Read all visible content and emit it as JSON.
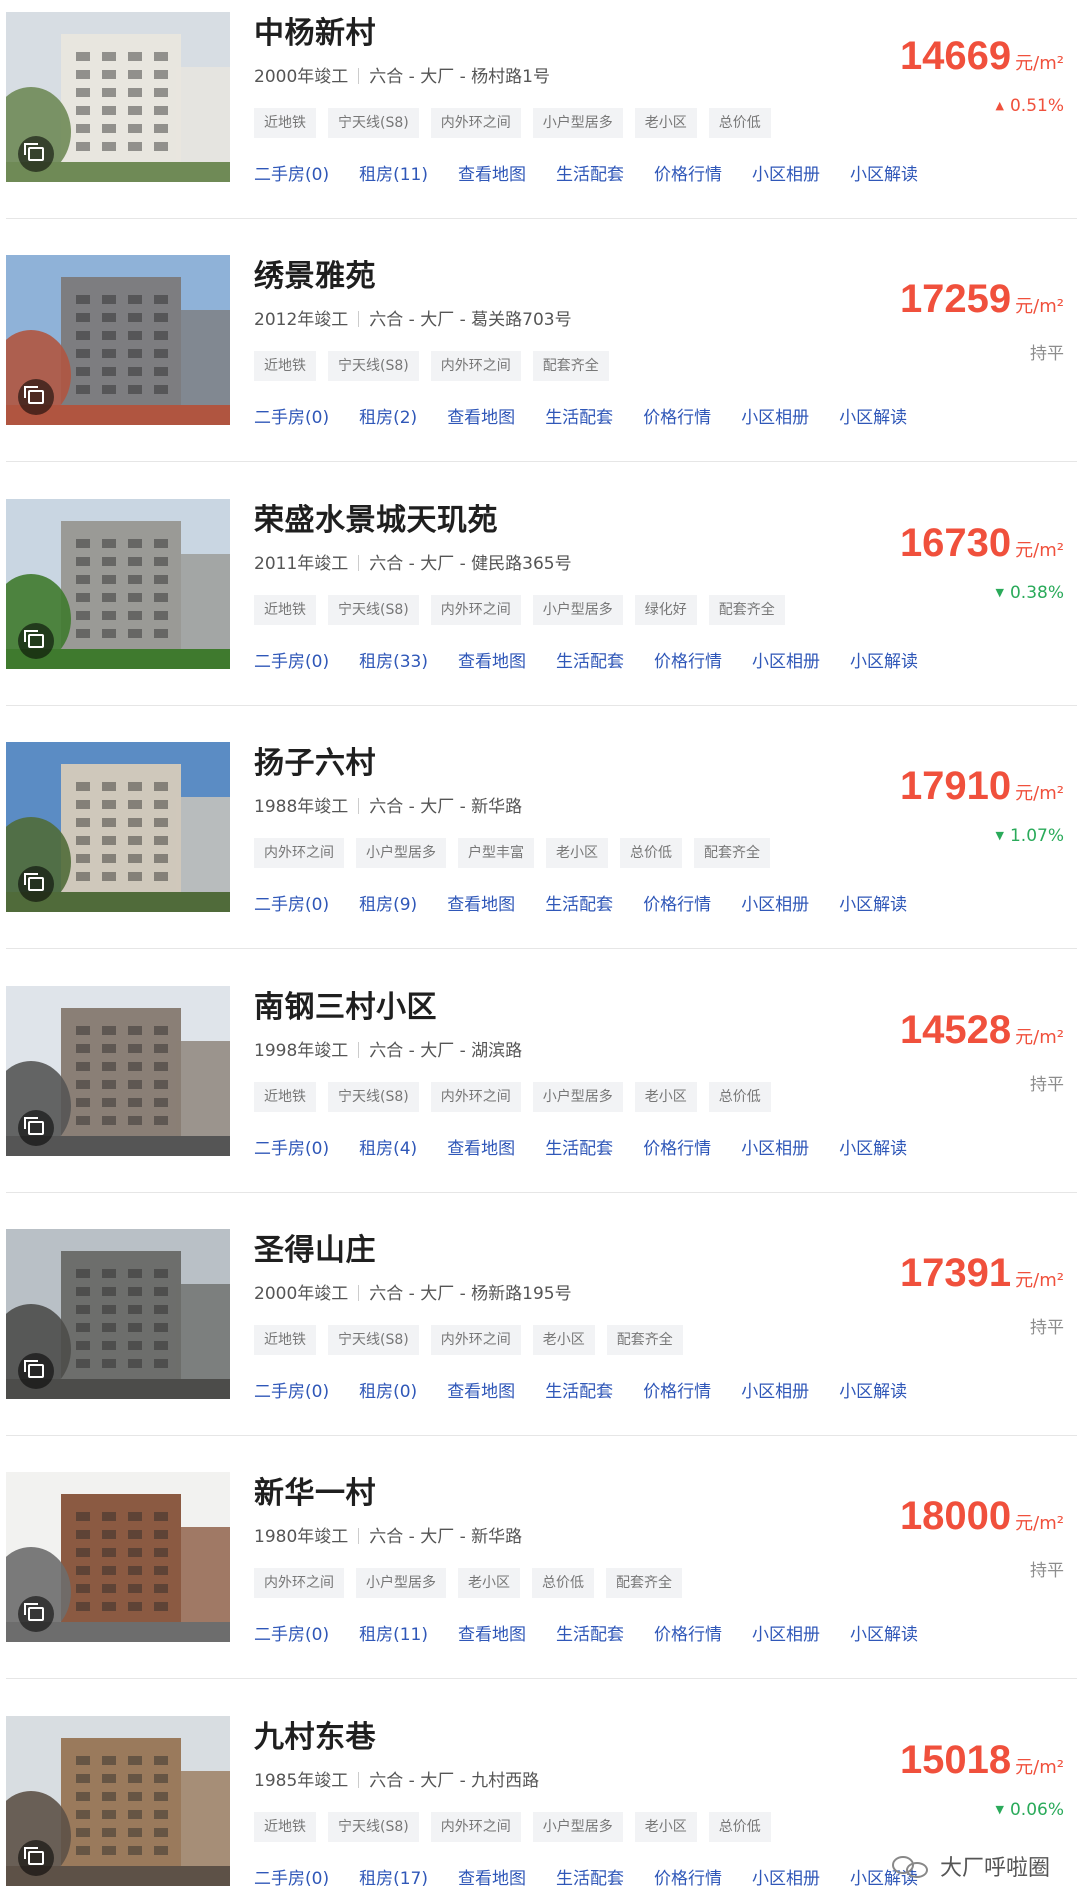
{
  "units": {
    "price_unit": "元/m²",
    "flat_label": "持平"
  },
  "listings": [
    {
      "name": "中杨新村",
      "year": "2000年竣工",
      "location": "六合 - 大厂 - 杨村路1号",
      "tags": [
        "近地铁",
        "宁天线(S8)",
        "内外环之间",
        "小户型居多",
        "老小区",
        "总价低"
      ],
      "links": [
        "二手房(0)",
        "租房(11)",
        "查看地图",
        "生活配套",
        "价格行情",
        "小区相册",
        "小区解读"
      ],
      "price": "14669",
      "trend": "up",
      "change": "0.51%",
      "photo_colors": {
        "sky": "#d7dde3",
        "building": "#e8e6df",
        "ground": "#6f8a56"
      }
    },
    {
      "name": "绣景雅苑",
      "year": "2012年竣工",
      "location": "六合 - 大厂 - 葛关路703号",
      "tags": [
        "近地铁",
        "宁天线(S8)",
        "内外环之间",
        "配套齐全"
      ],
      "links": [
        "二手房(0)",
        "租房(2)",
        "查看地图",
        "生活配套",
        "价格行情",
        "小区相册",
        "小区解读"
      ],
      "price": "17259",
      "trend": "flat",
      "change": "持平",
      "photo_colors": {
        "sky": "#8fb2d8",
        "building": "#7d7d80",
        "ground": "#b05540"
      }
    },
    {
      "name": "荣盛水景城天玑苑",
      "year": "2011年竣工",
      "location": "六合 - 大厂 - 健民路365号",
      "tags": [
        "近地铁",
        "宁天线(S8)",
        "内外环之间",
        "小户型居多",
        "绿化好",
        "配套齐全"
      ],
      "links": [
        "二手房(0)",
        "租房(33)",
        "查看地图",
        "生活配套",
        "价格行情",
        "小区相册",
        "小区解读"
      ],
      "price": "16730",
      "trend": "down",
      "change": "0.38%",
      "photo_colors": {
        "sky": "#c9d6e2",
        "building": "#9a9a96",
        "ground": "#3f7a2e"
      }
    },
    {
      "name": "扬子六村",
      "year": "1988年竣工",
      "location": "六合 - 大厂 - 新华路",
      "tags": [
        "内外环之间",
        "小户型居多",
        "户型丰富",
        "老小区",
        "总价低",
        "配套齐全"
      ],
      "links": [
        "二手房(0)",
        "租房(9)",
        "查看地图",
        "生活配套",
        "价格行情",
        "小区相册",
        "小区解读"
      ],
      "price": "17910",
      "trend": "down",
      "change": "1.07%",
      "photo_colors": {
        "sky": "#5b8cc4",
        "building": "#cfc8bb",
        "ground": "#506b3a"
      }
    },
    {
      "name": "南钢三村小区",
      "year": "1998年竣工",
      "location": "六合 - 大厂 - 湖滨路",
      "tags": [
        "近地铁",
        "宁天线(S8)",
        "内外环之间",
        "小户型居多",
        "老小区",
        "总价低"
      ],
      "links": [
        "二手房(0)",
        "租房(4)",
        "查看地图",
        "生活配套",
        "价格行情",
        "小区相册",
        "小区解读"
      ],
      "price": "14528",
      "trend": "flat",
      "change": "持平",
      "photo_colors": {
        "sky": "#dfe4ea",
        "building": "#8a7f76",
        "ground": "#555"
      }
    },
    {
      "name": "圣得山庄",
      "year": "2000年竣工",
      "location": "六合 - 大厂 - 杨新路195号",
      "tags": [
        "近地铁",
        "宁天线(S8)",
        "内外环之间",
        "老小区",
        "配套齐全"
      ],
      "links": [
        "二手房(0)",
        "租房(0)",
        "查看地图",
        "生活配套",
        "价格行情",
        "小区相册",
        "小区解读"
      ],
      "price": "17391",
      "trend": "flat",
      "change": "持平",
      "photo_colors": {
        "sky": "#b9c0c6",
        "building": "#6d6e6c",
        "ground": "#4c4c4a"
      }
    },
    {
      "name": "新华一村",
      "year": "1980年竣工",
      "location": "六合 - 大厂 - 新华路",
      "tags": [
        "内外环之间",
        "小户型居多",
        "老小区",
        "总价低",
        "配套齐全"
      ],
      "links": [
        "二手房(0)",
        "租房(11)",
        "查看地图",
        "生活配套",
        "价格行情",
        "小区相册",
        "小区解读"
      ],
      "price": "18000",
      "trend": "flat",
      "change": "持平",
      "photo_colors": {
        "sky": "#f2f2f0",
        "building": "#8b5a42",
        "ground": "#6d6d6d"
      }
    },
    {
      "name": "九村东巷",
      "year": "1985年竣工",
      "location": "六合 - 大厂 - 九村西路",
      "tags": [
        "近地铁",
        "宁天线(S8)",
        "内外环之间",
        "小户型居多",
        "老小区",
        "总价低"
      ],
      "links": [
        "二手房(0)",
        "租房(17)",
        "查看地图",
        "生活配套",
        "价格行情",
        "小区相册",
        "小区解读"
      ],
      "price": "15018",
      "trend": "down",
      "change": "0.06%",
      "photo_colors": {
        "sky": "#d8dde1",
        "building": "#9a7a5c",
        "ground": "#5d5147"
      }
    }
  ],
  "watermark": {
    "text": "大厂呼啦圈"
  }
}
